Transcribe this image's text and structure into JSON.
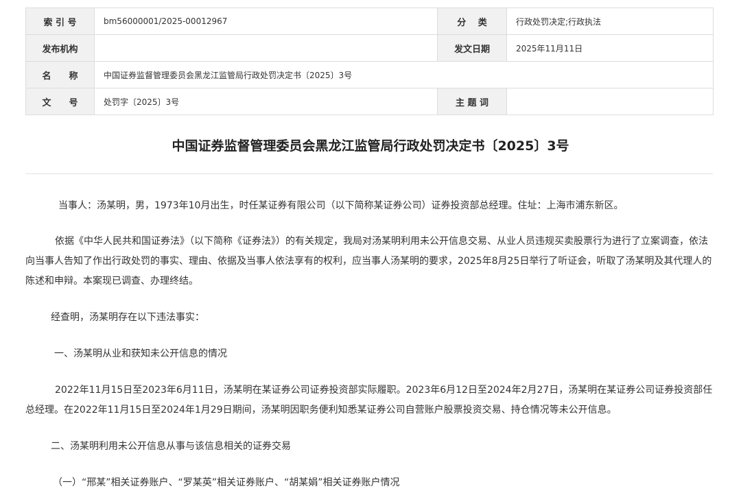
{
  "meta": {
    "index_label": "索 引 号",
    "index_value": "bm56000001/2025-00012967",
    "category_label": "分　 类",
    "category_value": "行政处罚决定;行政执法",
    "publisher_label": "发布机构",
    "publisher_value": "",
    "date_label": "发文日期",
    "date_value": "2025年11月11日",
    "name_label": "名　　称",
    "name_value": "中国证券监督管理委员会黑龙江监管局行政处罚决定书〔2025〕3号",
    "docno_label": "文　　号",
    "docno_value": "处罚字〔2025〕3号",
    "keywords_label": "主 题 词",
    "keywords_value": ""
  },
  "document": {
    "title": "中国证券监督管理委员会黑龙江监管局行政处罚决定书〔2025〕3号",
    "p1": "当事人：汤某明，男，1973年10月出生，时任某证券有限公司（以下简称某证券公司）证券投资部总经理。住址：上海市浦东新区。",
    "p2": "依据《中华人民共和国证券法》（以下简称《证券法》）的有关规定，我局对汤某明利用未公开信息交易、从业人员违规买卖股票行为进行了立案调查，依法向当事人告知了作出行政处罚的事实、理由、依据及当事人依法享有的权利，应当事人汤某明的要求，2025年8月25日举行了听证会，听取了汤某明及其代理人的陈述和申辩。本案现已调查、办理终结。",
    "p3": "经查明，汤某明存在以下违法事实：",
    "p4": "一、汤某明从业和获知未公开信息的情况",
    "p5": "2022年11月15日至2023年6月11日，汤某明在某证券公司证券投资部实际履职。2023年6月12日至2024年2月27日，汤某明在某证券公司证券投资部任总经理。在2022年11月15日至2024年1月29日期间，汤某明因职务便利知悉某证券公司自营账户股票投资交易、持仓情况等未公开信息。",
    "p6": "二、汤某明利用未公开信息从事与该信息相关的证券交易",
    "p7": "（一）“邢某”相关证券账户、“罗某英”相关证券账户、“胡某娟”相关证券账户情况"
  }
}
